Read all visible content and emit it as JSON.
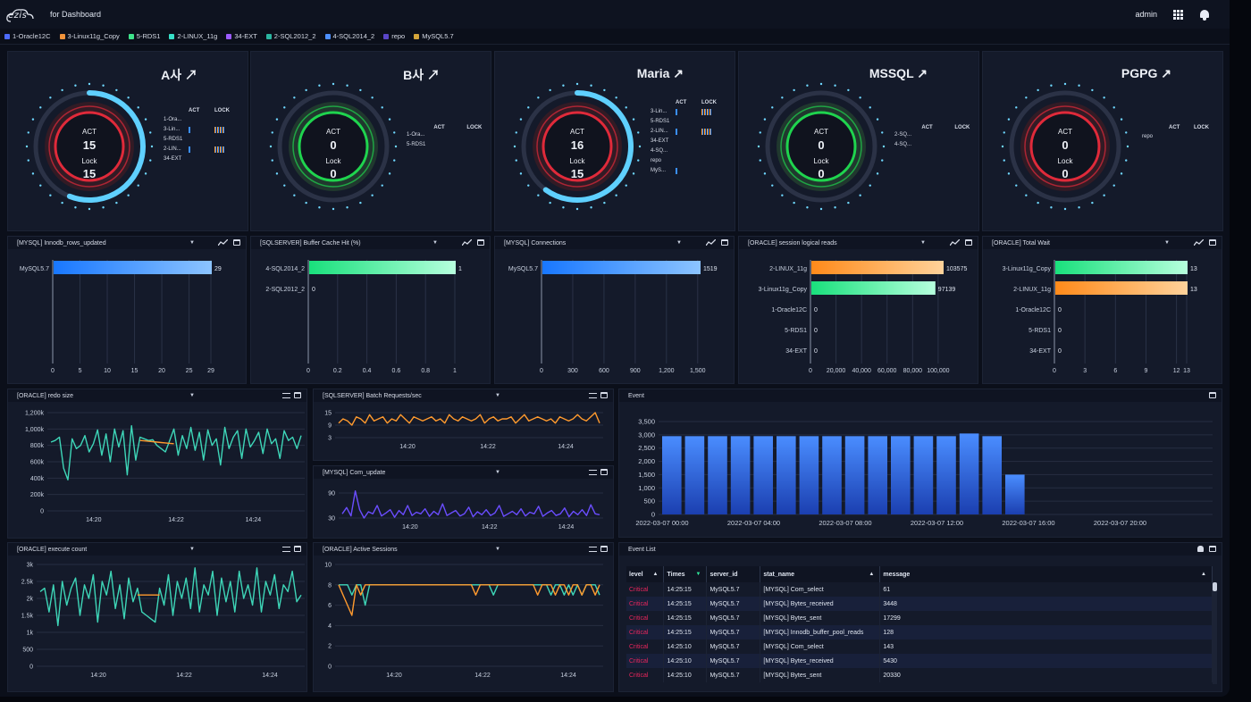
{
  "app": {
    "logo": "ezis",
    "subtitle": "for Dashboard",
    "user": "admin"
  },
  "filters": [
    {
      "label": "1-Oracle12C",
      "color": "#4d6bff"
    },
    {
      "label": "3-Linux11g_Copy",
      "color": "#f0923a"
    },
    {
      "label": "5-RDS1",
      "color": "#3ee38b"
    },
    {
      "label": "2-LINUX_11g",
      "color": "#37e0c8"
    },
    {
      "label": "34-EXT",
      "color": "#9b5bff"
    },
    {
      "label": "2-SQL2012_2",
      "color": "#2bb5a0"
    },
    {
      "label": "4-SQL2014_2",
      "color": "#4d8fff"
    },
    {
      "label": "repo",
      "color": "#5a46c8"
    },
    {
      "label": "MySQL5.7",
      "color": "#d4a53a"
    }
  ],
  "gauges": [
    {
      "title": "A사 ↗",
      "act_label": "ACT",
      "act": "15",
      "lock_label": "Lock",
      "lock": "15",
      "ring": "red",
      "arc": 0.56,
      "legend_hdr": [
        "ACT",
        "LOCK"
      ],
      "rows": [
        {
          "name": "1-Ora...",
          "act": 0,
          "lock": 0
        },
        {
          "name": "3-Lin...",
          "act": 1,
          "lock": 5
        },
        {
          "name": "5-RDS1",
          "act": 0,
          "lock": 0
        },
        {
          "name": "2-LIN...",
          "act": 1,
          "lock": 5
        },
        {
          "name": "34-EXT",
          "act": 0,
          "lock": 0
        }
      ]
    },
    {
      "title": "B사 ↗",
      "act_label": "ACT",
      "act": "0",
      "lock_label": "Lock",
      "lock": "0",
      "ring": "green",
      "arc": 0,
      "legend_hdr": [
        "ACT",
        "LOCK"
      ],
      "rows": [
        {
          "name": "1-Ora...",
          "act": 0,
          "lock": 0
        },
        {
          "name": "5-RDS1",
          "act": 0,
          "lock": 0
        }
      ]
    },
    {
      "title": "Maria ↗",
      "act_label": "ACT",
      "act": "16",
      "lock_label": "Lock",
      "lock": "15",
      "ring": "red",
      "arc": 0.6,
      "legend_hdr": [
        "ACT",
        "LOCK"
      ],
      "rows": [
        {
          "name": "3-Lin...",
          "act": 1,
          "lock": 5
        },
        {
          "name": "5-RDS1",
          "act": 0,
          "lock": 0
        },
        {
          "name": "2-LIN...",
          "act": 1,
          "lock": 5
        },
        {
          "name": "34-EXT",
          "act": 0,
          "lock": 0
        },
        {
          "name": "4-SQ...",
          "act": 0,
          "lock": 0
        },
        {
          "name": "repo",
          "act": 0,
          "lock": 0
        },
        {
          "name": "MyS...",
          "act": 1,
          "lock": 0
        }
      ]
    },
    {
      "title": "MSSQL ↗",
      "act_label": "ACT",
      "act": "0",
      "lock_label": "Lock",
      "lock": "0",
      "ring": "green",
      "arc": 0,
      "legend_hdr": [
        "ACT",
        "LOCK"
      ],
      "rows": [
        {
          "name": "2-SQ...",
          "act": 0,
          "lock": 0
        },
        {
          "name": "4-SQ...",
          "act": 0,
          "lock": 0
        }
      ]
    },
    {
      "title": "PGPG ↗",
      "act_label": "ACT",
      "act": "0",
      "lock_label": "Lock",
      "lock": "0",
      "ring": "red",
      "arc": 0,
      "legend_hdr": [
        "ACT",
        "LOCK"
      ],
      "rows": [
        {
          "name": "repo",
          "act": 0,
          "lock": 0
        }
      ]
    }
  ],
  "bar_panels": [
    {
      "title": "[MYSQL] Innodb_rows_updated"
    },
    {
      "title": "[SQLSERVER] Buffer Cache Hit (%)"
    },
    {
      "title": "[MYSQL] Connections"
    },
    {
      "title": "[ORACLE] session logical reads"
    },
    {
      "title": "[ORACLE] Total Wait"
    }
  ],
  "line_panels": [
    {
      "title": "[ORACLE] redo size"
    },
    {
      "title": "[SQLSERVER] Batch Requests/sec"
    },
    {
      "title": "[MYSQL] Com_update"
    },
    {
      "title": "[ORACLE] execute count"
    },
    {
      "title": "[ORACLE] Active Sessions"
    }
  ],
  "event_panel": {
    "title": "Event"
  },
  "event_list": {
    "title": "Event List",
    "columns": [
      "level",
      "Times",
      "server_id",
      "stat_name",
      "message"
    ],
    "rows": [
      [
        "Critical",
        "14:25:15",
        "MySQL5.7",
        "[MYSQL] Com_select",
        "61"
      ],
      [
        "Critical",
        "14:25:15",
        "MySQL5.7",
        "[MYSQL] Bytes_received",
        "3448"
      ],
      [
        "Critical",
        "14:25:15",
        "MySQL5.7",
        "[MYSQL] Bytes_sent",
        "17299"
      ],
      [
        "Critical",
        "14:25:15",
        "MySQL5.7",
        "[MYSQL] Innodb_buffer_pool_reads",
        "128"
      ],
      [
        "Critical",
        "14:25:10",
        "MySQL5.7",
        "[MYSQL] Com_select",
        "143"
      ],
      [
        "Critical",
        "14:25:10",
        "MySQL5.7",
        "[MYSQL] Bytes_received",
        "5430"
      ],
      [
        "Critical",
        "14:25:10",
        "MySQL5.7",
        "[MYSQL] Bytes_sent",
        "20330"
      ]
    ]
  },
  "colors": {
    "blue": "#1e8cff",
    "green": "#2fe89a",
    "orange": "#ff9a2e",
    "teal": "#3ed6b8",
    "purple": "#6a4dff",
    "critical": "#e7265c"
  },
  "chart_data": [
    {
      "type": "bar",
      "orientation": "horizontal",
      "categories": [
        "MySQL5.7"
      ],
      "values": [
        29
      ],
      "colors": [
        "blue"
      ],
      "xlim": [
        0,
        29
      ],
      "xticks": [
        "0",
        "5",
        "10",
        "15",
        "20",
        "25",
        "29"
      ]
    },
    {
      "type": "bar",
      "orientation": "horizontal",
      "categories": [
        "4-SQL2014_2",
        "2-SQL2012_2"
      ],
      "values": [
        1,
        0
      ],
      "colors": [
        "green",
        "green"
      ],
      "xlim": [
        0,
        1
      ],
      "xticks": [
        "0",
        "0.2",
        "0.4",
        "0.6",
        "0.8",
        "1"
      ]
    },
    {
      "type": "bar",
      "orientation": "horizontal",
      "categories": [
        "MySQL5.7"
      ],
      "values": [
        1519
      ],
      "colors": [
        "blue"
      ],
      "xlim": [
        0,
        1519
      ],
      "xticks": [
        "0",
        "300",
        "600",
        "900",
        "1,200",
        "1,500"
      ],
      "xtick_values": [
        0,
        300,
        600,
        900,
        1200,
        1500
      ]
    },
    {
      "type": "bar",
      "orientation": "horizontal",
      "categories": [
        "2-LINUX_11g",
        "3-Linux11g_Copy",
        "1-Oracle12C",
        "5-RDS1",
        "34-EXT"
      ],
      "values": [
        103575,
        97139,
        0,
        0,
        0
      ],
      "colors": [
        "orange",
        "green",
        "green",
        "green",
        "green"
      ],
      "xlim": [
        0,
        103575
      ],
      "xticks": [
        "0",
        "20,000",
        "40,000",
        "60,000",
        "80,000",
        "100,000"
      ],
      "xtick_values": [
        0,
        20000,
        40000,
        60000,
        80000,
        100000
      ]
    },
    {
      "type": "bar",
      "orientation": "horizontal",
      "categories": [
        "3-Linux11g_Copy",
        "2-LINUX_11g",
        "1-Oracle12C",
        "5-RDS1",
        "34-EXT"
      ],
      "values": [
        13,
        13,
        0,
        0,
        0
      ],
      "colors": [
        "green",
        "orange",
        "green",
        "green",
        "green"
      ],
      "xlim": [
        0,
        13
      ],
      "xticks": [
        "0",
        "3",
        "6",
        "9",
        "12",
        "13"
      ],
      "xtick_values": [
        0,
        3,
        6,
        9,
        12,
        13
      ]
    },
    {
      "type": "line",
      "ylim": [
        0,
        1200000
      ],
      "yticks": [
        "0",
        "200k",
        "400k",
        "600k",
        "800k",
        "1,000k",
        "1,200k"
      ],
      "xticks": [
        "14:20",
        "14:22",
        "14:24"
      ],
      "series": [
        {
          "color": "teal",
          "values": [
            840000,
            860000,
            900000,
            520000,
            380000,
            880000,
            760000,
            800000,
            920000,
            720000,
            820000,
            990000,
            680000,
            940000,
            600000,
            1000000,
            780000,
            980000,
            440000,
            1040000,
            620000,
            900000,
            880000,
            860000,
            870000,
            800000,
            760000,
            720000,
            860000,
            1000000,
            680000,
            920000,
            760000,
            1020000,
            740000,
            960000,
            620000,
            990000,
            800000,
            880000,
            560000,
            1020000,
            760000,
            900000,
            980000,
            640000,
            1000000,
            780000,
            860000,
            960000,
            700000,
            1000000,
            820000,
            880000,
            640000,
            980000,
            860000,
            900000,
            760000,
            920000
          ]
        },
        {
          "color": "orange",
          "values": [
            null,
            null,
            null,
            null,
            null,
            null,
            null,
            null,
            null,
            null,
            null,
            null,
            null,
            null,
            null,
            null,
            null,
            null,
            null,
            null,
            null,
            860000,
            855000,
            850000,
            845000,
            840000,
            835000,
            830000,
            825000,
            820000,
            null,
            null,
            null,
            null,
            null,
            null,
            null,
            null,
            null,
            null,
            null,
            null,
            null,
            null,
            null,
            null,
            null,
            null,
            null,
            null,
            null,
            null,
            null,
            null,
            null,
            null,
            null,
            null,
            null,
            null
          ]
        }
      ]
    },
    {
      "type": "line",
      "ylim": [
        3,
        15
      ],
      "yticks": [
        "3",
        "9",
        "15"
      ],
      "xticks": [
        "14:20",
        "14:22",
        "14:24"
      ],
      "series": [
        {
          "color": "orange",
          "values": [
            10,
            12,
            11,
            9,
            13,
            12,
            10,
            14,
            11,
            12,
            13,
            10,
            12,
            11,
            14,
            12,
            10,
            13,
            12,
            11,
            12,
            13,
            11,
            12,
            10,
            14,
            12,
            11,
            13,
            12,
            11,
            12,
            14,
            10,
            12,
            13,
            11,
            12,
            12,
            13,
            10,
            12,
            14,
            11,
            12,
            13,
            12,
            11,
            12,
            10,
            13,
            12,
            11,
            12,
            14,
            12,
            11,
            13,
            15,
            10
          ]
        }
      ]
    },
    {
      "type": "line",
      "ylim": [
        30,
        90
      ],
      "yticks": [
        "30",
        "90"
      ],
      "xticks": [
        "14:20",
        "14:22",
        "14:24"
      ],
      "series": [
        {
          "color": "purple",
          "values": [
            40,
            55,
            35,
            95,
            50,
            30,
            45,
            40,
            60,
            35,
            42,
            50,
            32,
            48,
            38,
            60,
            36,
            44,
            40,
            52,
            34,
            46,
            38,
            64,
            36,
            42,
            48,
            35,
            40,
            56,
            33,
            45,
            38,
            50,
            36,
            42,
            60,
            34,
            40,
            46,
            38,
            52,
            35,
            44,
            40,
            58,
            34,
            42,
            48,
            36,
            40,
            54,
            33,
            46,
            38,
            50,
            36,
            62,
            40,
            38
          ]
        }
      ]
    },
    {
      "type": "line",
      "ylim": [
        0,
        3000
      ],
      "yticks": [
        "0",
        "500",
        "1k",
        "1.5k",
        "2k",
        "2.5k",
        "3k"
      ],
      "xticks": [
        "14:20",
        "14:22",
        "14:24"
      ],
      "series": [
        {
          "color": "teal",
          "values": [
            2200,
            2300,
            1600,
            2400,
            1200,
            2500,
            1800,
            2300,
            2600,
            1500,
            2400,
            2000,
            2700,
            1300,
            2500,
            2100,
            2800,
            1700,
            2400,
            1400,
            2600,
            1900,
            2300,
            1600,
            1500,
            1400,
            1300,
            2300,
            1800,
            2700,
            1500,
            2500,
            2000,
            2600,
            1700,
            2900,
            1600,
            2400,
            2100,
            2800,
            1500,
            2600,
            1900,
            2500,
            1600,
            2800,
            2000,
            2400,
            1800,
            2900,
            1600,
            2500,
            2100,
            2700,
            1700,
            2400,
            2200,
            2800,
            1900,
            2100
          ]
        },
        {
          "color": "orange",
          "values": [
            null,
            null,
            null,
            null,
            null,
            null,
            null,
            null,
            null,
            null,
            null,
            null,
            null,
            null,
            null,
            null,
            null,
            null,
            null,
            null,
            null,
            null,
            2100,
            2100,
            2100,
            2100,
            2100,
            2100,
            null,
            null,
            null,
            null,
            null,
            null,
            null,
            null,
            null,
            null,
            null,
            null,
            null,
            null,
            null,
            null,
            null,
            null,
            null,
            null,
            null,
            null,
            null,
            null,
            null,
            null,
            null,
            null,
            null,
            null,
            null,
            null
          ]
        }
      ]
    },
    {
      "type": "line",
      "ylim": [
        0,
        10
      ],
      "yticks": [
        "0",
        "2",
        "4",
        "6",
        "8",
        "10"
      ],
      "xticks": [
        "14:20",
        "14:22",
        "14:24"
      ],
      "series": [
        {
          "color": "teal",
          "values": [
            8,
            8,
            8,
            7,
            8,
            8,
            6,
            8,
            8,
            8,
            8,
            8,
            8,
            8,
            8,
            8,
            8,
            8,
            8,
            8,
            8,
            8,
            8,
            8,
            8,
            8,
            8,
            8,
            8,
            8,
            8,
            8,
            8,
            8,
            8,
            7,
            8,
            8,
            8,
            8,
            8,
            8,
            8,
            8,
            8,
            8,
            8,
            8,
            7,
            8,
            8,
            7,
            8,
            7,
            8,
            7,
            8,
            8,
            8,
            7
          ]
        },
        {
          "color": "orange",
          "values": [
            8,
            7,
            6,
            5,
            8,
            7,
            8,
            8,
            8,
            8,
            8,
            8,
            8,
            8,
            8,
            8,
            8,
            8,
            8,
            8,
            8,
            8,
            8,
            8,
            8,
            8,
            8,
            8,
            8,
            8,
            8,
            7,
            8,
            8,
            8,
            8,
            8,
            8,
            8,
            8,
            8,
            8,
            8,
            8,
            8,
            7,
            8,
            8,
            8,
            7,
            8,
            8,
            7,
            8,
            8,
            7,
            8,
            8,
            7,
            8
          ]
        }
      ]
    },
    {
      "type": "bar",
      "categories": [
        "2022-03-07 00:00",
        "2022-03-07 04:00",
        "2022-03-07 08:00",
        "2022-03-07 12:00",
        "2022-03-07 16:00",
        "2022-03-07 20:00"
      ],
      "xticks": [
        "2022-03-07 00:00",
        "2022-03-07 04:00",
        "2022-03-07 08:00",
        "2022-03-07 12:00",
        "2022-03-07 16:00",
        "2022-03-07 20:00"
      ],
      "values": [
        2950,
        2950,
        2950,
        2950,
        2950,
        2950,
        2950,
        2950,
        2950,
        2950,
        2950,
        2950,
        2950,
        3050,
        2950,
        1500
      ],
      "ylim": [
        0,
        3500
      ],
      "yticks": [
        "0",
        "500",
        "1,000",
        "1,500",
        "2,000",
        "2,500",
        "3,000",
        "3,500"
      ]
    }
  ]
}
